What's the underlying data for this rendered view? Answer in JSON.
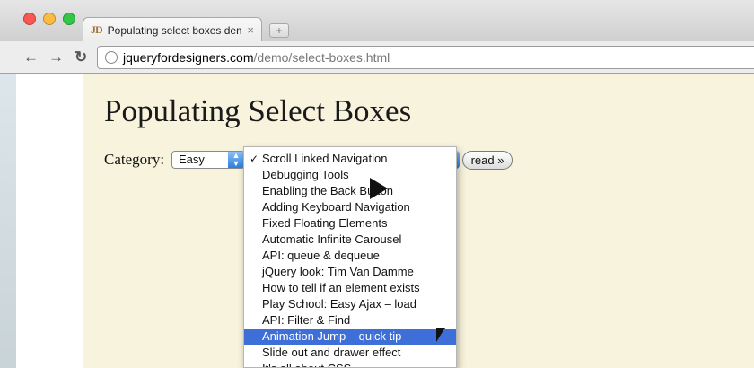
{
  "browser": {
    "tab_favicon": "JD",
    "tab_title": "Populating select boxes dem",
    "tab_close": "×",
    "new_tab": "+",
    "nav_back": "←",
    "nav_forward": "→",
    "nav_reload": "↻",
    "url_host": "jqueryfordesigners.com",
    "url_path": "/demo/select-boxes.html",
    "traffic_colors": [
      "#fc5753",
      "#fdbc40",
      "#33c748"
    ]
  },
  "page": {
    "heading": "Populating Select Boxes",
    "category_label": "Category:",
    "category_value": "Easy",
    "read_button": "read »"
  },
  "dropdown": {
    "checkmark": "✓",
    "options": [
      "Scroll Linked Navigation",
      "Debugging Tools",
      "Enabling the Back Button",
      "Adding Keyboard Navigation",
      "Fixed Floating Elements",
      "Automatic Infinite Carousel",
      "API: queue & dequeue",
      "jQuery look: Tim Van Damme",
      "How to tell if an element exists",
      "Play School: Easy Ajax – load",
      "API: Filter & Find",
      "Animation Jump – quick tip",
      "Slide out and drawer effect",
      "It's all about CSS"
    ],
    "checked_index": 0,
    "highlighted_index": 11
  }
}
